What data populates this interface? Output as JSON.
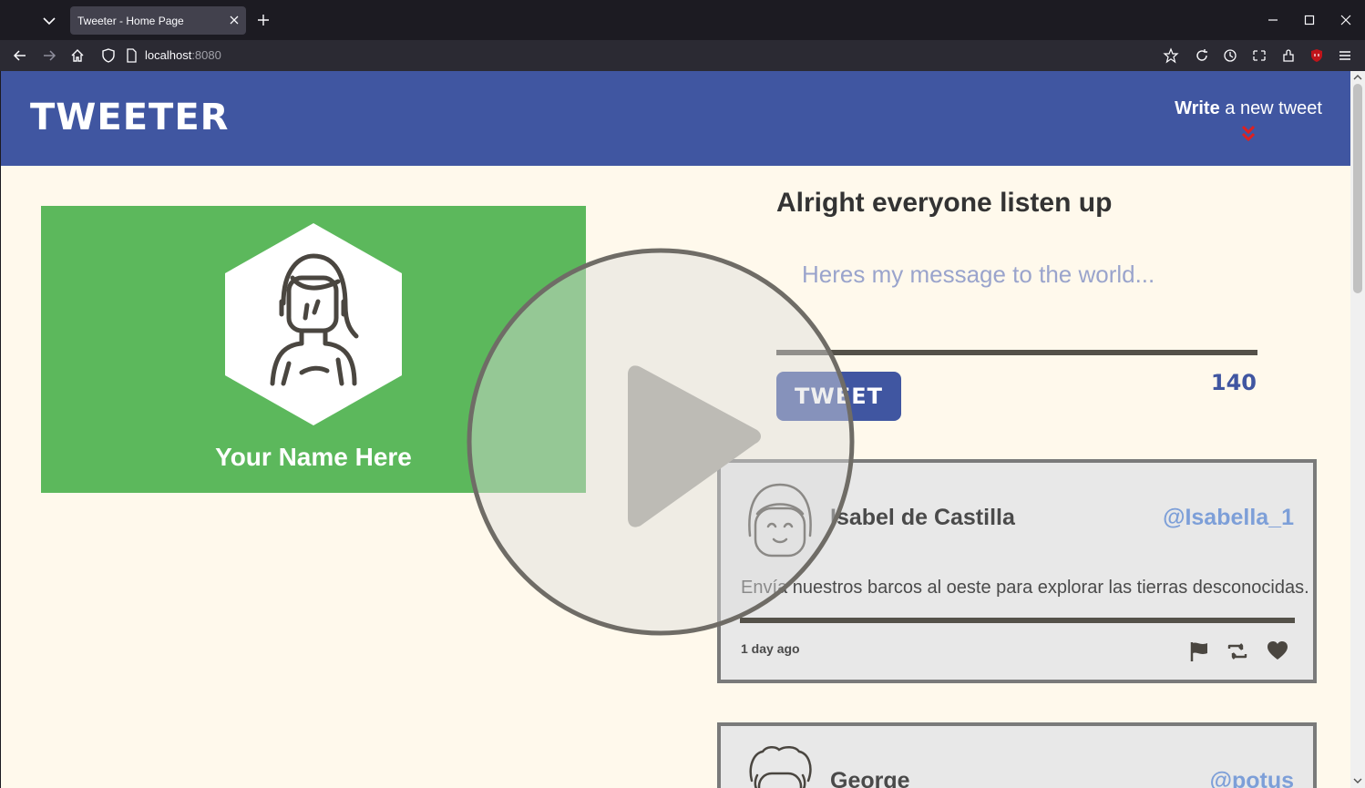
{
  "browser": {
    "tab_title": "Tweeter - Home Page",
    "url_host": "localhost",
    "url_port": ":8080"
  },
  "header": {
    "logo": "TWEETER",
    "write_bold": "Write",
    "write_rest": " a new tweet",
    "chevron_color": "#e0201f"
  },
  "profile": {
    "name": "Your Name Here",
    "card_color": "#5cb85c"
  },
  "compose": {
    "title": "Alright everyone listen up",
    "placeholder": "Heres my message to the world...",
    "button_label": "TWEET",
    "counter": "140"
  },
  "tweets": [
    {
      "name": "Isabel de Castilla",
      "handle": "@Isabella_1",
      "text": "Envía nuestros barcos al oeste para explorar las tierras desconocidas.",
      "time": "1 day ago",
      "actions": [
        "flag-icon",
        "retweet-icon",
        "heart-icon"
      ]
    },
    {
      "name": "George",
      "handle": "@potus"
    }
  ],
  "colors": {
    "brand": "#4056a1",
    "page_bg": "#fff9ec",
    "handle": "#7d9fd8"
  }
}
